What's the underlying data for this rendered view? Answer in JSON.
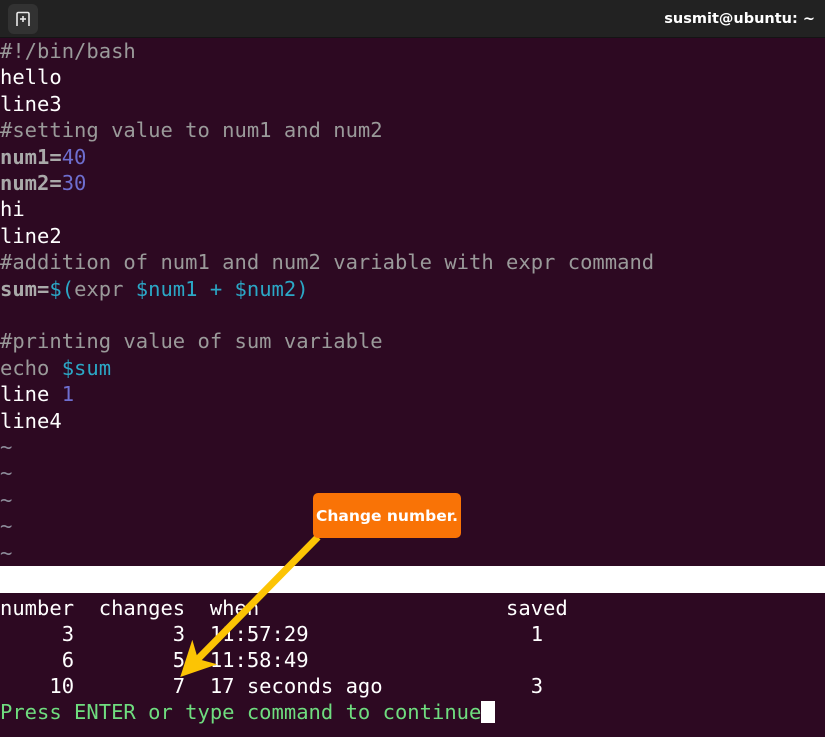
{
  "window": {
    "title": "susmit@ubuntu: ~",
    "new_tab_icon": "new-tab-icon",
    "background_color": "#2d0922",
    "titlebar_color": "#222222"
  },
  "editor": {
    "lines": [
      {
        "segments": [
          {
            "text": "#!/bin/bash",
            "style": "comment"
          }
        ]
      },
      {
        "segments": [
          {
            "text": "hello",
            "style": "white"
          }
        ]
      },
      {
        "segments": [
          {
            "text": "line3",
            "style": "white"
          }
        ]
      },
      {
        "segments": [
          {
            "text": "#setting value to num1 and num2",
            "style": "comment"
          }
        ]
      },
      {
        "segments": [
          {
            "text": "num1=",
            "style": "var"
          },
          {
            "text": "40",
            "style": "num"
          }
        ]
      },
      {
        "segments": [
          {
            "text": "num2=",
            "style": "var"
          },
          {
            "text": "30",
            "style": "num"
          }
        ]
      },
      {
        "segments": [
          {
            "text": "hi",
            "style": "white"
          }
        ]
      },
      {
        "segments": [
          {
            "text": "line2",
            "style": "white"
          }
        ]
      },
      {
        "segments": [
          {
            "text": "#addition of num1 and num2 variable with expr command",
            "style": "comment"
          }
        ]
      },
      {
        "segments": [
          {
            "text": "sum=",
            "style": "var"
          },
          {
            "text": "$(",
            "style": "cyan"
          },
          {
            "text": "expr ",
            "style": "comment"
          },
          {
            "text": "$num1",
            "style": "cyan"
          },
          {
            "text": " ",
            "style": "white"
          },
          {
            "text": "+",
            "style": "cyan"
          },
          {
            "text": " ",
            "style": "white"
          },
          {
            "text": "$num2)",
            "style": "cyan"
          }
        ]
      },
      {
        "segments": [
          {
            "text": "",
            "style": "white"
          }
        ]
      },
      {
        "segments": [
          {
            "text": "#printing value of sum variable",
            "style": "comment"
          }
        ]
      },
      {
        "segments": [
          {
            "text": "echo ",
            "style": "comment"
          },
          {
            "text": "$sum",
            "style": "cyan"
          }
        ]
      },
      {
        "segments": [
          {
            "text": "line ",
            "style": "white"
          },
          {
            "text": "1",
            "style": "num"
          }
        ]
      },
      {
        "segments": [
          {
            "text": "line4",
            "style": "white"
          }
        ]
      },
      {
        "segments": [
          {
            "text": "~",
            "style": "tilde"
          }
        ]
      },
      {
        "segments": [
          {
            "text": "~",
            "style": "tilde"
          }
        ]
      },
      {
        "segments": [
          {
            "text": "~",
            "style": "tilde"
          }
        ]
      },
      {
        "segments": [
          {
            "text": "~",
            "style": "tilde"
          }
        ]
      },
      {
        "segments": [
          {
            "text": "~",
            "style": "tilde"
          }
        ]
      }
    ]
  },
  "output": {
    "header": "number  changes  when                    saved",
    "rows": [
      "     3        3  11:57:29                  1",
      "     6        5  11:58:49",
      "    10        7  17 seconds ago            3"
    ],
    "prompt": "Press ENTER or type command to continue",
    "table": {
      "columns": [
        "number",
        "changes",
        "when",
        "saved"
      ],
      "data": [
        {
          "number": "3",
          "changes": "3",
          "when": "11:57:29",
          "saved": "1"
        },
        {
          "number": "6",
          "changes": "5",
          "when": "11:58:49",
          "saved": ""
        },
        {
          "number": "10",
          "changes": "7",
          "when": "17 seconds ago",
          "saved": "3"
        }
      ]
    }
  },
  "annotation": {
    "label": "Change number.",
    "box_color": "#f97306",
    "arrow_color": "#fcc404",
    "text_color": "#ffffff"
  }
}
